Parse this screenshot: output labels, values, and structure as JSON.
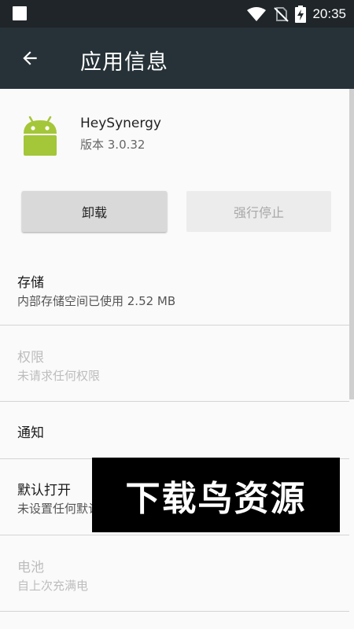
{
  "status_bar": {
    "time": "20:35",
    "icons": [
      "notification-icon",
      "wifi-icon",
      "no-sim-icon",
      "battery-charging-icon"
    ]
  },
  "app_bar": {
    "back_icon": "arrow-back-icon",
    "title": "应用信息"
  },
  "app": {
    "icon": "android-icon",
    "name": "HeySynergy",
    "version": "版本 3.0.32"
  },
  "buttons": {
    "uninstall": "卸载",
    "force_stop": "强行停止"
  },
  "settings": {
    "storage": {
      "title": "存储",
      "subtitle": "内部存储空间已使用 2.52 MB"
    },
    "permissions": {
      "title": "权限",
      "subtitle": "未请求任何权限"
    },
    "notifications": {
      "title": "通知"
    },
    "open_by_default": {
      "title": "默认打开",
      "subtitle": "未设置任何默认选项"
    },
    "battery": {
      "title": "电池",
      "subtitle": "自上次充满电"
    }
  },
  "watermark": {
    "text": "下载鸟资源"
  },
  "colors": {
    "status_bar": "#1f2529",
    "app_bar": "#263238",
    "android_green": "#a4c639"
  }
}
